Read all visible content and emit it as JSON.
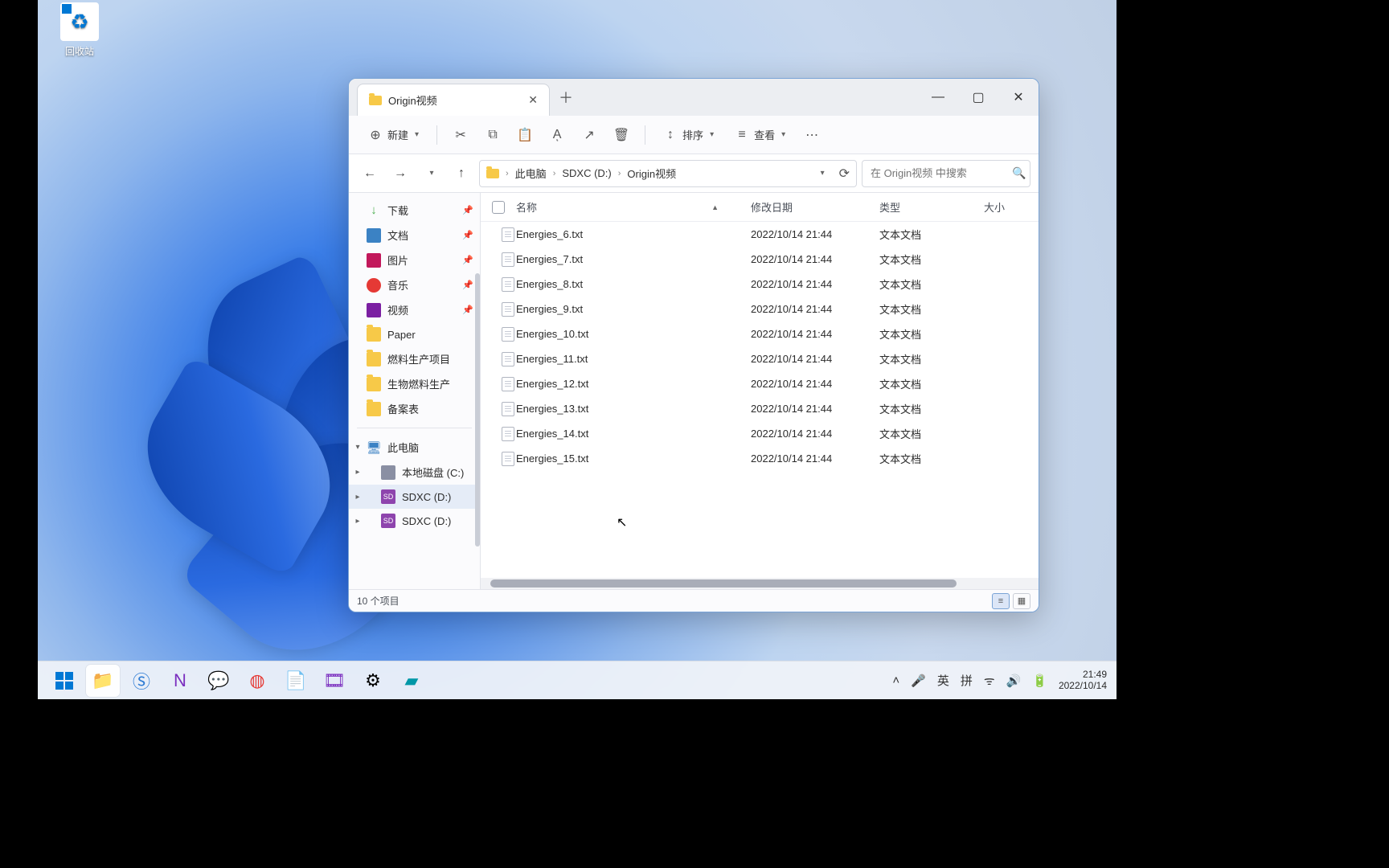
{
  "desktop": {
    "recycle_bin": "回收站"
  },
  "window": {
    "tab_title": "Origin视频",
    "toolbar": {
      "new": "新建",
      "sort": "排序",
      "view": "查看"
    },
    "breadcrumb": {
      "pc": "此电脑",
      "drive": "SDXC (D:)",
      "folder": "Origin视频"
    },
    "search_placeholder": "在 Origin视频 中搜索",
    "sidebar": {
      "downloads": "下载",
      "documents": "文档",
      "pictures": "图片",
      "music": "音乐",
      "videos": "视频",
      "paper": "Paper",
      "fuel_project": "燃料生产项目",
      "biofuel": "生物燃料生产",
      "record": "备案表",
      "this_pc": "此电脑",
      "local_c": "本地磁盘 (C:)",
      "sdxc_d_1": "SDXC (D:)",
      "sdxc_d_2": "SDXC (D:)"
    },
    "columns": {
      "name": "名称",
      "modified": "修改日期",
      "type": "类型",
      "size": "大小"
    },
    "files": [
      {
        "name": "Energies_6.txt",
        "date": "2022/10/14 21:44",
        "type": "文本文档"
      },
      {
        "name": "Energies_7.txt",
        "date": "2022/10/14 21:44",
        "type": "文本文档"
      },
      {
        "name": "Energies_8.txt",
        "date": "2022/10/14 21:44",
        "type": "文本文档"
      },
      {
        "name": "Energies_9.txt",
        "date": "2022/10/14 21:44",
        "type": "文本文档"
      },
      {
        "name": "Energies_10.txt",
        "date": "2022/10/14 21:44",
        "type": "文本文档"
      },
      {
        "name": "Energies_11.txt",
        "date": "2022/10/14 21:44",
        "type": "文本文档"
      },
      {
        "name": "Energies_12.txt",
        "date": "2022/10/14 21:44",
        "type": "文本文档"
      },
      {
        "name": "Energies_13.txt",
        "date": "2022/10/14 21:44",
        "type": "文本文档"
      },
      {
        "name": "Energies_14.txt",
        "date": "2022/10/14 21:44",
        "type": "文本文档"
      },
      {
        "name": "Energies_15.txt",
        "date": "2022/10/14 21:44",
        "type": "文本文档"
      }
    ],
    "status": "10 个项目"
  },
  "taskbar": {
    "ime_lang": "英",
    "ime_mode": "拼"
  },
  "clock": {
    "time": "21:49",
    "date": "2022/10/14"
  }
}
